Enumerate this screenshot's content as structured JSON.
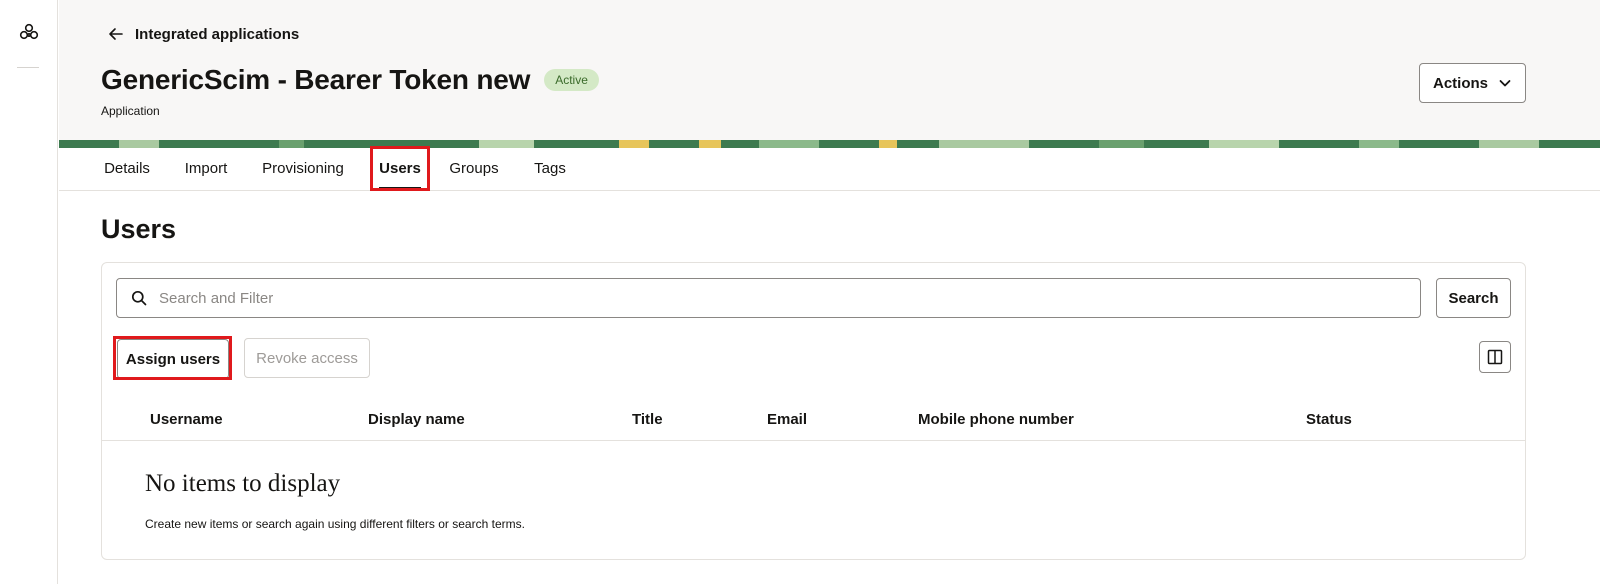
{
  "rail": {
    "logo_icon": "oracle-hub-icon"
  },
  "header": {
    "back_label": "Integrated applications",
    "title": "GenericScim - Bearer Token new",
    "status_badge": "Active",
    "subtitle": "Application",
    "actions_label": "Actions"
  },
  "tabs": [
    {
      "label": "Details"
    },
    {
      "label": "Import"
    },
    {
      "label": "Provisioning"
    },
    {
      "label": "Users",
      "active": true
    },
    {
      "label": "Groups"
    },
    {
      "label": "Tags"
    }
  ],
  "section": {
    "title": "Users"
  },
  "search": {
    "placeholder": "Search and Filter",
    "value": "",
    "button_label": "Search"
  },
  "toolbar": {
    "assign_label": "Assign users",
    "revoke_label": "Revoke access",
    "columns_icon": "columns-icon"
  },
  "table": {
    "columns": [
      "Username",
      "Display name",
      "Title",
      "Email",
      "Mobile phone number",
      "Status"
    ],
    "rows": []
  },
  "empty_state": {
    "title": "No items to display",
    "description": "Create new items or search again using different filters or search terms."
  },
  "colors": {
    "highlight": "#e0191c",
    "badge_bg": "#d4e9c6",
    "header_bg": "#f8f7f6",
    "banner_green": "#3d7a4f"
  }
}
